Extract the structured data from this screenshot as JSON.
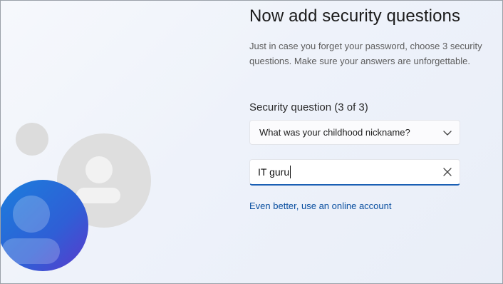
{
  "header": {
    "title": "Now add security questions",
    "subtitle": "Just in case you forget your password, choose 3 security questions. Make sure your answers are unforgettable."
  },
  "form": {
    "question_label": "Security question (3 of 3)",
    "question_selected": "What was your childhood nickname?",
    "answer_value": "IT guru",
    "online_account_link": "Even better, use an online account"
  },
  "icons": {
    "dropdown": "chevron-down-icon",
    "clear": "close-icon",
    "illustration": "user-avatar-icon"
  },
  "colors": {
    "accent": "#1a5fb4",
    "link": "#0a4fa0",
    "avatar_blue_start": "#1f7ad6",
    "avatar_blue_end": "#5a3ccf",
    "avatar_gray": "#dedede"
  }
}
